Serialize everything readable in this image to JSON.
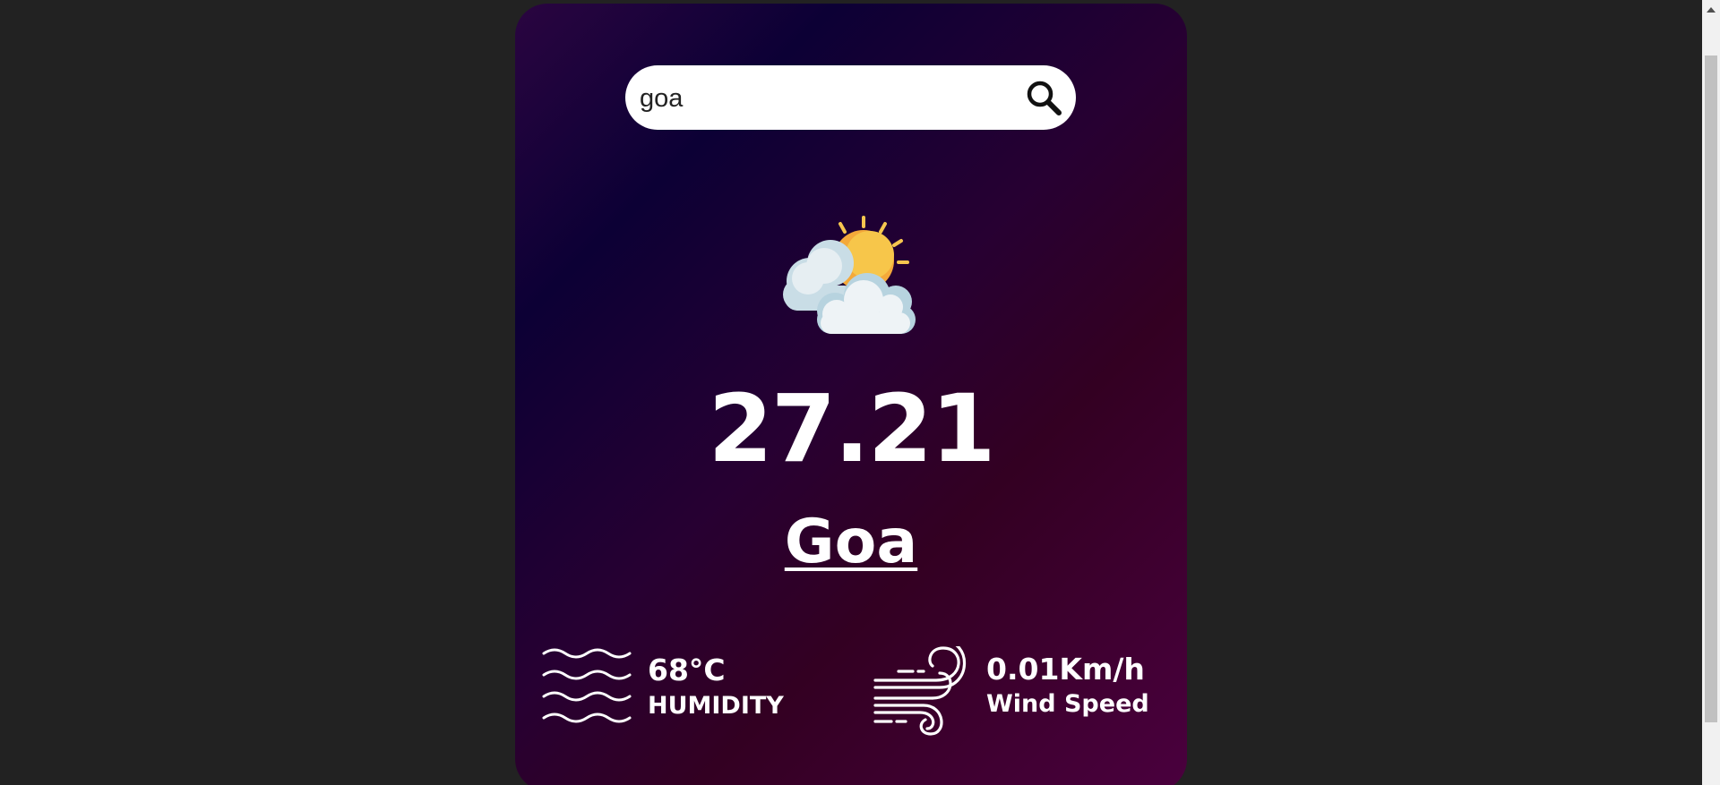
{
  "search": {
    "value": "goa",
    "icon": "search-icon"
  },
  "weather": {
    "icon": "partly-cloudy-icon",
    "temperature": "27.21",
    "city": "Goa"
  },
  "humidity": {
    "icon": "humidity-waves-icon",
    "value": "68°C",
    "label": "HUMIDITY"
  },
  "wind": {
    "icon": "wind-icon",
    "value": "0.01Km/h",
    "label": "Wind Speed"
  },
  "colors": {
    "page_background": "#222222",
    "card_gradient_start": "#2a0540",
    "card_gradient_end": "#4a003e",
    "text": "#ffffff",
    "sun": "#f6b93b",
    "cloud": "#e8eef2"
  }
}
